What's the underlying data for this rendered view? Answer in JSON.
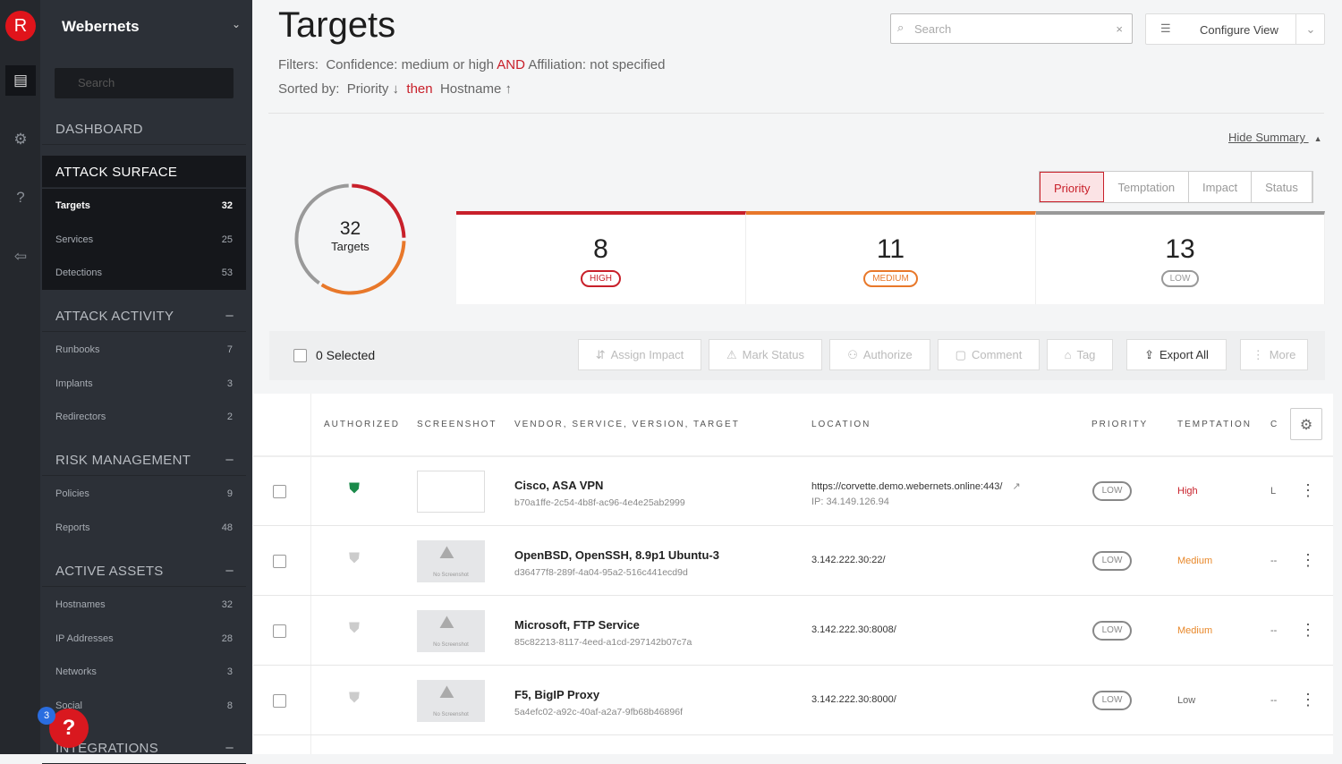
{
  "app": {
    "logo_letter": "R",
    "org": "Webernets",
    "help_badge": "3",
    "help_glyph": "?"
  },
  "sidebar": {
    "search_placeholder": "Search",
    "dashboard": "DASHBOARD",
    "attack_surface": {
      "title": "ATTACK SURFACE",
      "items": [
        {
          "label": "Targets",
          "count": "32"
        },
        {
          "label": "Services",
          "count": "25"
        },
        {
          "label": "Detections",
          "count": "53"
        }
      ]
    },
    "attack_activity": {
      "title": "ATTACK ACTIVITY",
      "items": [
        {
          "label": "Runbooks",
          "count": "7"
        },
        {
          "label": "Implants",
          "count": "3"
        },
        {
          "label": "Redirectors",
          "count": "2"
        }
      ]
    },
    "risk_management": {
      "title": "RISK MANAGEMENT",
      "items": [
        {
          "label": "Policies",
          "count": "9"
        },
        {
          "label": "Reports",
          "count": "48"
        }
      ]
    },
    "active_assets": {
      "title": "ACTIVE ASSETS",
      "items": [
        {
          "label": "Hostnames",
          "count": "32"
        },
        {
          "label": "IP Addresses",
          "count": "28"
        },
        {
          "label": "Networks",
          "count": "3"
        },
        {
          "label": "Social",
          "count": "8"
        }
      ]
    },
    "integrations": {
      "title": "INTEGRATIONS"
    }
  },
  "header": {
    "title": "Targets",
    "filters_label": "Filters:",
    "filter1": "Confidence: medium or high",
    "filter_and": "AND",
    "filter2": "Affiliation: not specified",
    "sorted_label": "Sorted by:",
    "sort1": "Priority ↓",
    "sort_then": "then",
    "sort2": "Hostname ↑",
    "search_placeholder": "Search",
    "configure_view": "Configure View"
  },
  "summary": {
    "hide_label": "Hide Summary",
    "tabs": [
      "Priority",
      "Temptation",
      "Impact",
      "Status"
    ],
    "active_tab": "Priority",
    "total": "32",
    "total_label": "Targets",
    "cards": [
      {
        "count": "8",
        "label": "HIGH",
        "color": "#c8202a"
      },
      {
        "count": "11",
        "label": "MEDIUM",
        "color": "#e8782a"
      },
      {
        "count": "13",
        "label": "LOW",
        "color": "#999999"
      }
    ]
  },
  "toolbar": {
    "selected": "0 Selected",
    "assign_impact": "Assign Impact",
    "mark_status": "Mark Status",
    "authorize": "Authorize",
    "comment": "Comment",
    "tag": "Tag",
    "export_all": "Export All",
    "more": "More"
  },
  "table": {
    "headers": {
      "authorized": "AUTHORIZED",
      "screenshot": "SCREENSHOT",
      "vendor": "VENDOR, SERVICE, VERSION, TARGET",
      "location": "LOCATION",
      "priority": "PRIORITY",
      "temptation": "TEMPTATION",
      "truncated": "C"
    },
    "no_screenshot": "No Screenshot",
    "rows": [
      {
        "authorized": true,
        "title": "Cisco, ASA VPN",
        "id": "b70a1ffe-2c54-4b8f-ac96-4e4e25ab2999",
        "location": "https://corvette.demo.webernets.online:443/",
        "ip": "IP: 34.149.126.94",
        "priority": "LOW",
        "temptation": "High",
        "temptation_color": "#c8202a",
        "extra": "L"
      },
      {
        "authorized": false,
        "title": "OpenBSD, OpenSSH, 8.9p1 Ubuntu-3",
        "id": "d36477f8-289f-4a04-95a2-516c441ecd9d",
        "location": "3.142.222.30:22/",
        "priority": "LOW",
        "temptation": "Medium",
        "temptation_color": "#e8882a",
        "extra": "--"
      },
      {
        "authorized": false,
        "title": "Microsoft, FTP Service",
        "id": "85c82213-8117-4eed-a1cd-297142b07c7a",
        "location": "3.142.222.30:8008/",
        "priority": "LOW",
        "temptation": "Medium",
        "temptation_color": "#e8882a",
        "extra": "--"
      },
      {
        "authorized": false,
        "title": "F5, BigIP Proxy",
        "id": "5a4efc02-a92c-40af-a2a7-9fb68b46896f",
        "location": "3.142.222.30:8000/",
        "priority": "LOW",
        "temptation": "Low",
        "temptation_color": "#666666",
        "extra": "--"
      }
    ]
  }
}
